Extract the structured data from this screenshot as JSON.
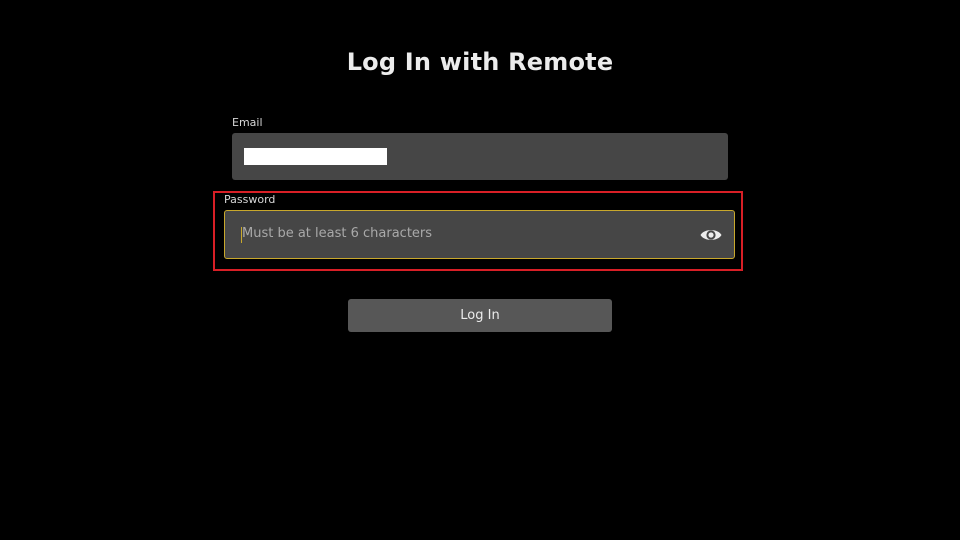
{
  "page": {
    "title": "Log In with Remote"
  },
  "email": {
    "label": "Email",
    "value_redacted": true
  },
  "password": {
    "label": "Password",
    "placeholder": "Must be at least 6 characters",
    "toggle_icon": "eye-icon",
    "focused": true
  },
  "login": {
    "label": "Log In"
  },
  "colors": {
    "background": "#000000",
    "field_background": "#464646",
    "focus_border": "#c8a82c",
    "highlight_box": "#d81f26",
    "button_background": "#575757"
  }
}
